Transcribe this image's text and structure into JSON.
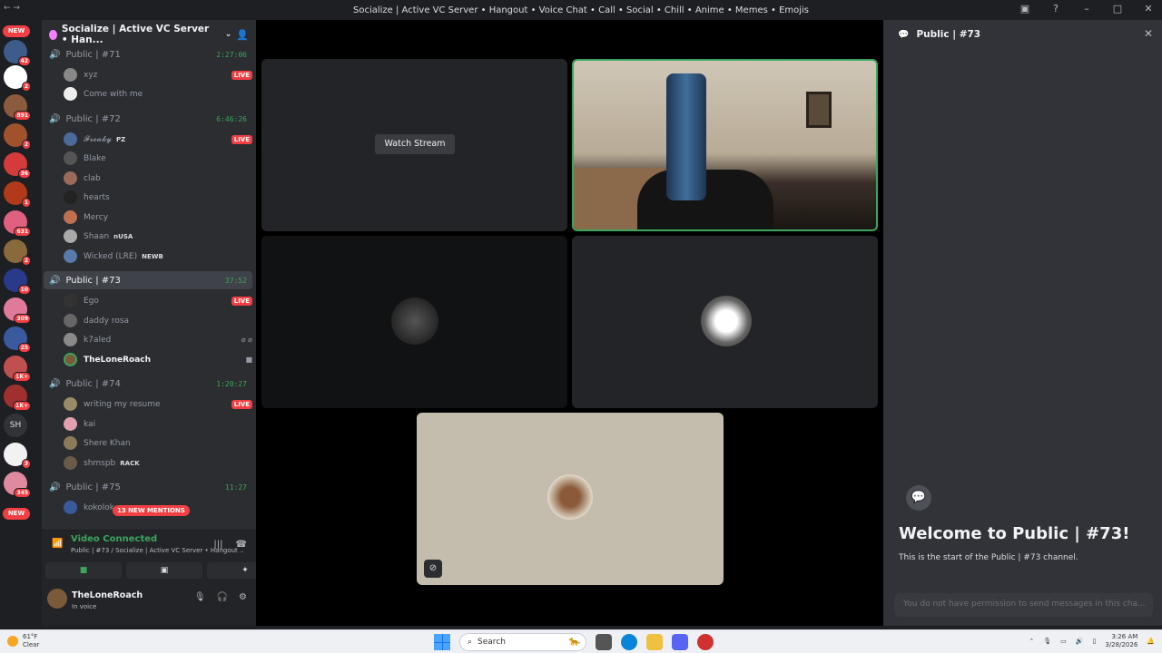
{
  "window": {
    "title": "Socialize | Active VC Server • Hangout • Voice Chat • Call • Social • Chill • Anime • Memes • Emojis"
  },
  "rail": {
    "new_top": "NEW",
    "new_bottom": "NEW",
    "badges": [
      "42",
      "2",
      "891",
      "2",
      "36",
      "1",
      "631",
      "2",
      "10",
      "309",
      "25",
      "1K+",
      "1K+",
      "3",
      "345"
    ],
    "sh_label": "SH"
  },
  "sidebar": {
    "server_name": "Socialize | Active VC Server • Han...",
    "channels": [
      {
        "name": "Public | #71",
        "time": "2:27:06"
      },
      {
        "name": "Public | #72",
        "time": "6:46:26"
      },
      {
        "name": "Public | #73",
        "time": "37:52"
      },
      {
        "name": "Public | #74",
        "time": "1:20:27"
      },
      {
        "name": "Public | #75",
        "time": "11:27"
      }
    ],
    "users71": [
      {
        "name": "xyz",
        "live": "LIVE"
      },
      {
        "name": "Come with me"
      }
    ],
    "users72": [
      {
        "name": "𝓕𝓻𝓮𝓪𝓴𝔂",
        "tag": "PZ",
        "live": "LIVE"
      },
      {
        "name": "Blake"
      },
      {
        "name": "clab"
      },
      {
        "name": "hearts"
      },
      {
        "name": "Mercy"
      },
      {
        "name": "Shaan",
        "tag": "nUSA"
      },
      {
        "name": "Wicked (LRE)",
        "tag": "NEWB"
      }
    ],
    "users73": [
      {
        "name": "Ego",
        "live": "LIVE"
      },
      {
        "name": "daddy rosa"
      },
      {
        "name": "k7aled"
      },
      {
        "name": "TheLoneRoach"
      }
    ],
    "users74": [
      {
        "name": "writing my resume",
        "live": "LIVE"
      },
      {
        "name": "kai"
      },
      {
        "name": "Shere Khan"
      },
      {
        "name": "shmspb",
        "tag": "RACK"
      }
    ],
    "users75": [
      {
        "name": "kokolok"
      }
    ],
    "mentions": "13 NEW MENTIONS"
  },
  "voice": {
    "status": "Video Connected",
    "location": "Public | #73 / Socialize | Active VC Server • Hangout ..."
  },
  "user_panel": {
    "name": "TheLoneRoach",
    "status": "In voice"
  },
  "stage": {
    "watch_stream": "Watch Stream"
  },
  "right_panel": {
    "title": "Public | #73",
    "welcome": "Welcome to Public | #73!",
    "start": "This is the start of the Public | #73 channel.",
    "no_permission": "You do not have permission to send messages in this cha..."
  },
  "taskbar": {
    "weather_temp": "61°F",
    "weather_desc": "Clear",
    "search": "Search",
    "time": "3:26 AM",
    "date": "3/28/2026"
  },
  "colors": {
    "accent_green": "#3ba55c",
    "live_red": "#f23f43",
    "bg_dark": "#1e1f22"
  }
}
